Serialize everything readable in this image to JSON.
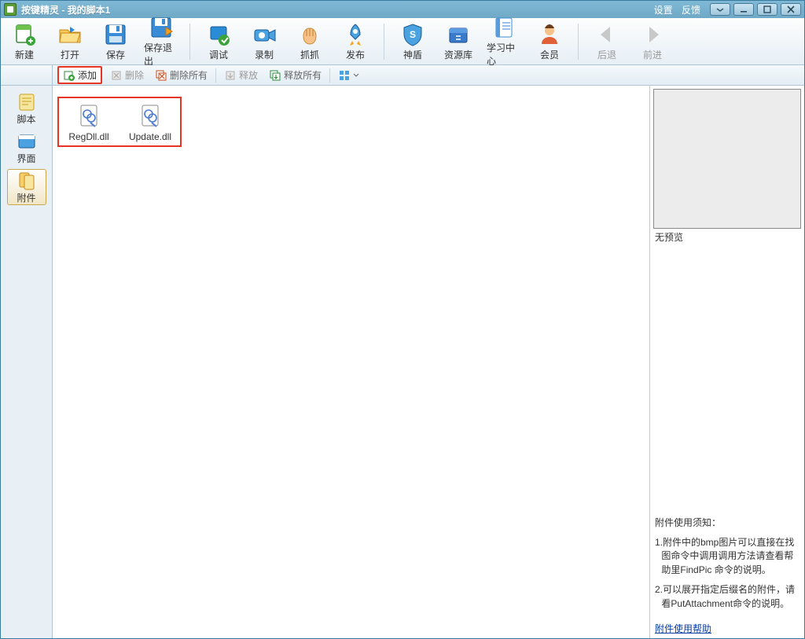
{
  "title": "按键精灵  -  我的脚本1",
  "topLinks": {
    "settings": "设置",
    "feedback": "反馈"
  },
  "mainToolbar": {
    "new": "新建",
    "open": "打开",
    "save": "保存",
    "saveExit": "保存退出",
    "debug": "调试",
    "record": "录制",
    "capture": "抓抓",
    "publish": "发布",
    "shield": "神盾",
    "repo": "资源库",
    "learn": "学习中心",
    "member": "会员",
    "back": "后退",
    "forward": "前进"
  },
  "subToolbar": {
    "add": "添加",
    "delete": "删除",
    "deleteAll": "删除所有",
    "release": "释放",
    "releaseAll": "释放所有"
  },
  "leftNav": {
    "script": "脚本",
    "ui": "界面",
    "attach": "附件"
  },
  "files": [
    {
      "name": "RegDll.dll"
    },
    {
      "name": "Update.dll"
    }
  ],
  "right": {
    "noPreview": "无预览",
    "noticeTitle": "附件使用须知：",
    "note1": "1.附件中的bmp图片可以直接在找图命令中调用调用方法请查看帮助里FindPic 命令的说明。",
    "note2": "2.可以展开指定后缀名的附件，请看PutAttachment命令的说明。",
    "helpLink": "附件使用帮助"
  }
}
